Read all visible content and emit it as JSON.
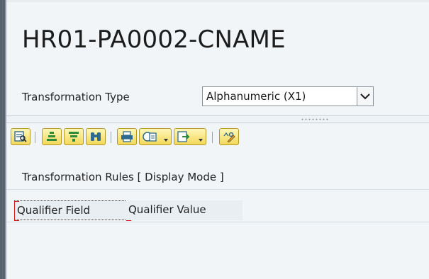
{
  "header": {
    "title": "HR01-PA0002-CNAME"
  },
  "transformation": {
    "label": "Transformation Type",
    "selected": "Alphanumeric (X1)"
  },
  "toolbar": {
    "buttons": [
      {
        "icon": "details-icon"
      },
      {
        "icon": "sort-ascending-icon"
      },
      {
        "icon": "filter-icon"
      },
      {
        "icon": "find-icon"
      },
      {
        "icon": "print-icon"
      },
      {
        "icon": "views-icon"
      },
      {
        "icon": "export-icon"
      },
      {
        "icon": "display-change-icon"
      }
    ]
  },
  "section": {
    "title": "Transformation Rules [ Display Mode ]"
  },
  "table": {
    "columns": [
      "Qualifier Field",
      "Qualifier Value"
    ]
  },
  "colors": {
    "button_fill": "#f3d85a",
    "button_border": "#b49a24",
    "focus_red": "#d21b1b",
    "panel_bg": "#f1f5f8"
  }
}
